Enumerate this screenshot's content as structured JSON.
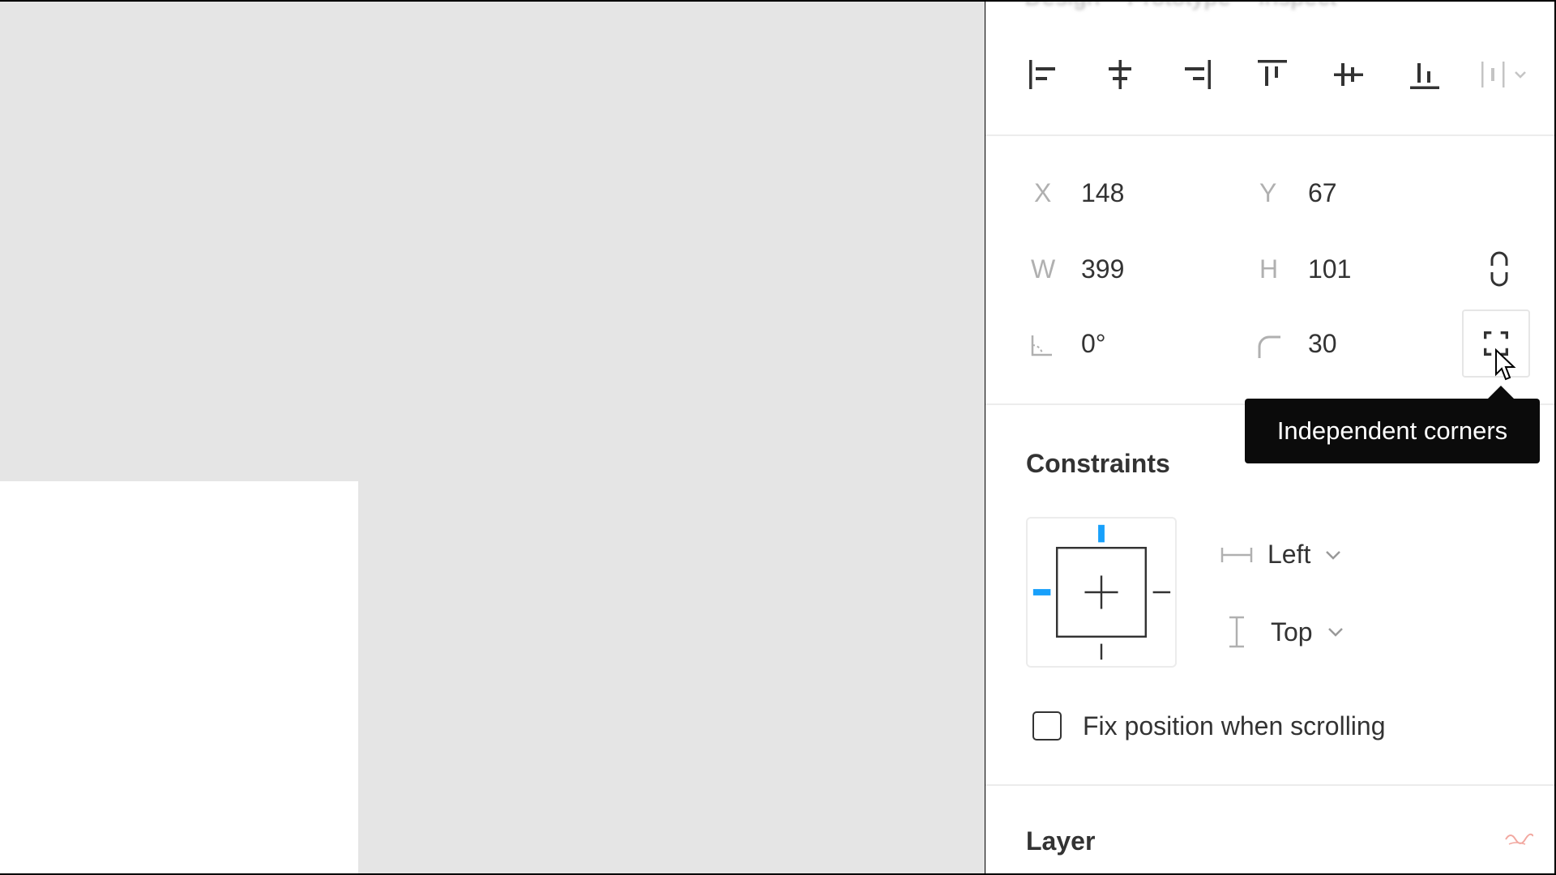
{
  "panel": {
    "position": {
      "x_label": "X",
      "x_value": "148",
      "y_label": "Y",
      "y_value": "67",
      "w_label": "W",
      "w_value": "399",
      "h_label": "H",
      "h_value": "101",
      "rotation_value": "0°",
      "radius_value": "30"
    },
    "tooltip": "Independent corners",
    "constraints": {
      "title": "Constraints",
      "horizontal": "Left",
      "vertical": "Top",
      "fix_position_label": "Fix position when scrolling"
    },
    "layer": {
      "title": "Layer"
    }
  },
  "colors": {
    "accent": "#18a0fb",
    "canvas": "#e5e5e5",
    "tooltip_bg": "#0b0b0b"
  },
  "icons": {
    "align": [
      "align-left-icon",
      "align-horizontal-center-icon",
      "align-right-icon",
      "align-top-icon",
      "align-vertical-center-icon",
      "align-bottom-icon",
      "distribute-icon"
    ],
    "position": [
      "rotation-icon",
      "corner-radius-icon",
      "constrain-proportions-icon",
      "independent-corners-icon"
    ]
  }
}
